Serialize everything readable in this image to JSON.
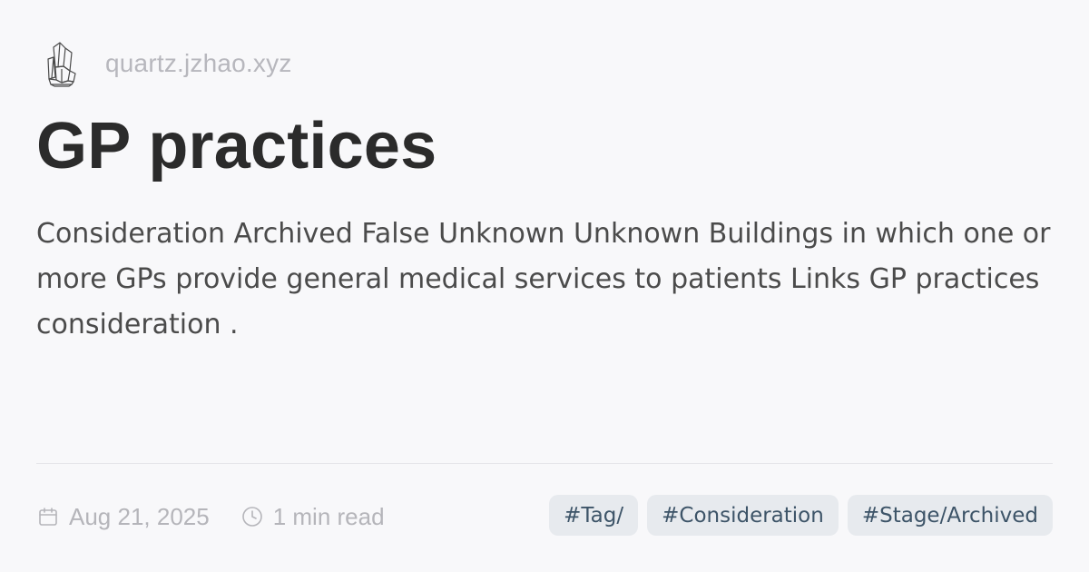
{
  "site": {
    "logo_icon": "crystal-cluster-icon",
    "domain": "quartz.jzhao.xyz"
  },
  "page": {
    "title": "GP practices",
    "description": "Consideration Archived False Unknown Unknown Buildings in which one or more GPs provide general medical services to patients Links GP practices consideration ."
  },
  "meta": {
    "date_icon": "calendar-icon",
    "date": "Aug 21, 2025",
    "read_icon": "clock-icon",
    "reading_time": "1 min read"
  },
  "tags": [
    {
      "label": "#Tag/"
    },
    {
      "label": "#Consideration"
    },
    {
      "label": "#Stage/Archived"
    }
  ],
  "colors": {
    "background": "#f8f8fa",
    "title": "#2b2b2b",
    "body_text": "#4b4b4b",
    "muted_text": "#b5b5ba",
    "tag_background": "#e7eaee",
    "tag_text": "#3d5468"
  }
}
